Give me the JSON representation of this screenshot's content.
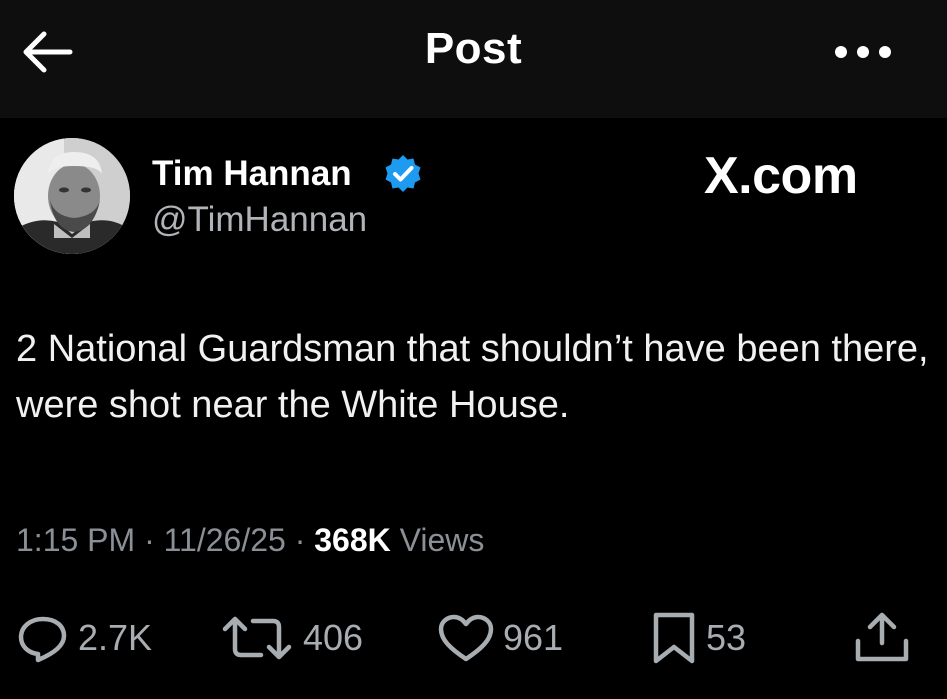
{
  "header": {
    "title": "Post",
    "back_icon": "arrow-left-icon",
    "more_icon": "more-horizontal-icon"
  },
  "author": {
    "name": "Tim Hannan",
    "handle": "@TimHannan",
    "verified": true,
    "verified_color": "#1d9bf0"
  },
  "watermark": "X.com",
  "post": {
    "text": "2 National Guardsman that shouldn’t have been there, were shot near the White House.",
    "time": "1:15 PM",
    "separator": "·",
    "date": "11/26/25",
    "views_count": "368K",
    "views_label": "Views"
  },
  "actions": {
    "replies": "2.7K",
    "reposts": "406",
    "likes": "961",
    "bookmarks": "53"
  },
  "colors": {
    "background": "#000000",
    "header_background": "#0e0e0e",
    "primary_text": "#e7e9ea",
    "secondary_text": "#8b9096"
  }
}
